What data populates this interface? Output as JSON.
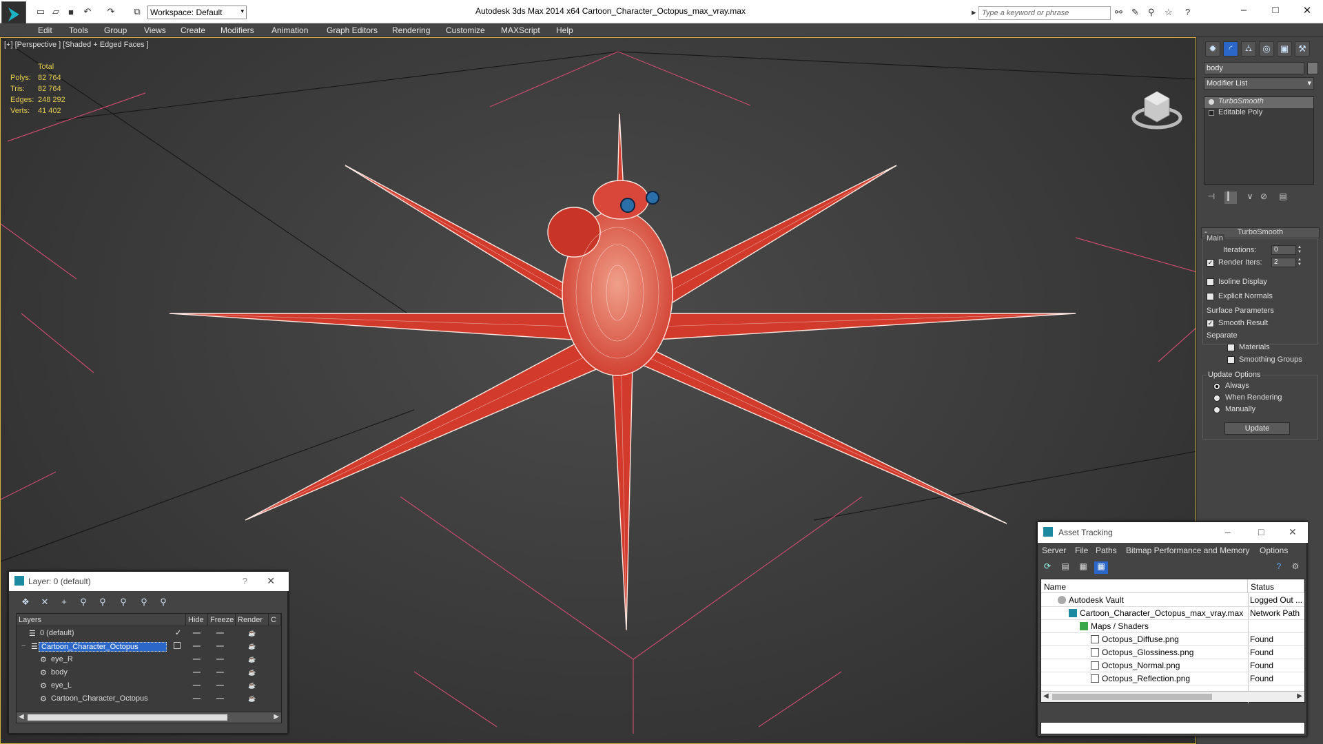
{
  "titlebar": {
    "workspace": "Workspace: Default",
    "window_title": "Autodesk 3ds Max  2014 x64      Cartoon_Character_Octopus_max_vray.max",
    "search_placeholder": "Type a keyword or phrase"
  },
  "menu": [
    "Edit",
    "Tools",
    "Group",
    "Views",
    "Create",
    "Modifiers",
    "Animation",
    "Graph Editors",
    "Rendering",
    "Customize",
    "MAXScript",
    "Help"
  ],
  "viewport": {
    "label": "[+] [Perspective ] [Shaded + Edged Faces ]",
    "stats": {
      "header": "Total",
      "rows": [
        {
          "k": "Polys:",
          "v": "82 764"
        },
        {
          "k": "Tris:",
          "v": "82 764"
        },
        {
          "k": "Edges:",
          "v": "248 292"
        },
        {
          "k": "Verts:",
          "v": "41 402"
        }
      ]
    },
    "octopus_color": "#d23a2c"
  },
  "command_panel": {
    "object_name": "body",
    "modifier_list": "Modifier List",
    "stack": [
      "TurboSmooth",
      "Editable Poly"
    ],
    "turbosmooth": {
      "title": "TurboSmooth",
      "main": "Main",
      "iterations_label": "Iterations:",
      "iterations": "0",
      "render_iters_label": "Render Iters:",
      "render_iters": "2",
      "isoline": "Isoline Display",
      "explicit": "Explicit Normals",
      "surface_params": "Surface Parameters",
      "smooth_result": "Smooth Result",
      "separate": "Separate",
      "materials": "Materials",
      "smoothing_groups": "Smoothing Groups",
      "update_options": "Update Options",
      "always": "Always",
      "when_rendering": "When Rendering",
      "manually": "Manually",
      "update_button": "Update"
    }
  },
  "layer_window": {
    "title": "Layer: 0 (default)",
    "question": "?",
    "headers": [
      "Layers",
      "Hide",
      "Freeze",
      "Render",
      "C"
    ],
    "rows": [
      {
        "name": "0 (default)"
      },
      {
        "name": "Cartoon_Character_Octopus"
      },
      {
        "name": "eye_R"
      },
      {
        "name": "body"
      },
      {
        "name": "eye_L"
      },
      {
        "name": "Cartoon_Character_Octopus"
      }
    ]
  },
  "asset_window": {
    "title": "Asset Tracking",
    "menu": [
      "Server",
      "File",
      "Paths",
      "Bitmap Performance and Memory",
      "Options"
    ],
    "headers": [
      "Name",
      "Status"
    ],
    "rows": [
      {
        "name": "Autodesk Vault",
        "status": "Logged Out ..."
      },
      {
        "name": "Cartoon_Character_Octopus_max_vray.max",
        "status": "Network Path"
      },
      {
        "name": "Maps / Shaders",
        "status": ""
      },
      {
        "name": "Octopus_Diffuse.png",
        "status": "Found"
      },
      {
        "name": "Octopus_Glossiness.png",
        "status": "Found"
      },
      {
        "name": "Octopus_Normal.png",
        "status": "Found"
      },
      {
        "name": "Octopus_Reflection.png",
        "status": "Found"
      }
    ]
  }
}
